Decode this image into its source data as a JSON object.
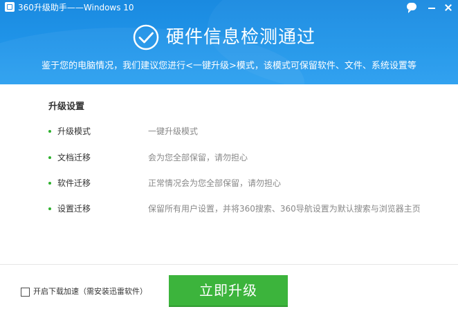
{
  "window": {
    "title": "360升级助手——Windows 10"
  },
  "header": {
    "headline": "硬件信息检测通过",
    "subline": "鉴于您的电脑情况，我们建议您进行<一键升级>模式，该模式可保留软件、文件、系统设置等"
  },
  "settings": {
    "title": "升级设置",
    "items": [
      {
        "label": "升级模式",
        "value": "一键升级模式"
      },
      {
        "label": "文档迁移",
        "value": "会为您全部保留，请勿担心"
      },
      {
        "label": "软件迁移",
        "value": "正常情况会为您全部保留，请勿担心"
      },
      {
        "label": "设置迁移",
        "value": "保留所有用户设置，并将360搜索、360导航设置为默认搜索与浏览器主页"
      }
    ]
  },
  "footer": {
    "accelerate_label": "开启下载加速（需安装迅雷软件）",
    "accelerate_checked": false,
    "upgrade_button": "立即升级"
  },
  "colors": {
    "header_blue": "#2196ea",
    "accent_green": "#3cb43c"
  },
  "icons": {
    "header_check": "check-circle-icon"
  }
}
